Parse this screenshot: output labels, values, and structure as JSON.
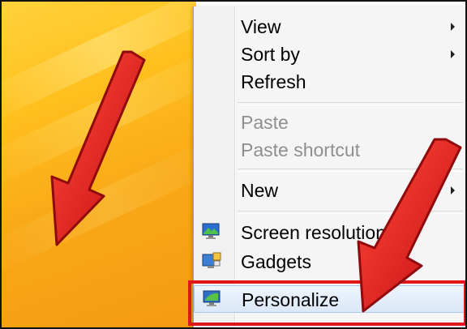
{
  "context_menu": {
    "items": [
      {
        "label": "View",
        "submenu": true,
        "disabled": false
      },
      {
        "label": "Sort by",
        "submenu": true,
        "disabled": false
      },
      {
        "label": "Refresh",
        "submenu": false,
        "disabled": false
      },
      {
        "label": "Paste",
        "submenu": false,
        "disabled": true
      },
      {
        "label": "Paste shortcut",
        "submenu": false,
        "disabled": true
      },
      {
        "label": "New",
        "submenu": true,
        "disabled": false
      },
      {
        "label": "Screen resolution",
        "submenu": false,
        "disabled": false,
        "icon": "screen-resolution-icon"
      },
      {
        "label": "Gadgets",
        "submenu": false,
        "disabled": false,
        "icon": "gadgets-icon"
      },
      {
        "label": "Personalize",
        "submenu": false,
        "disabled": false,
        "icon": "personalize-icon",
        "highlighted": true
      }
    ]
  },
  "colors": {
    "desktop": "#f8a816",
    "menu_background": "#f5f5f5",
    "disabled_text": "#8f8f8f",
    "annotation_red": "#e0161b"
  },
  "annotations": {
    "arrows": [
      "pointing-arrow-left",
      "pointing-arrow-right"
    ],
    "highlight_box_target": "Personalize"
  }
}
